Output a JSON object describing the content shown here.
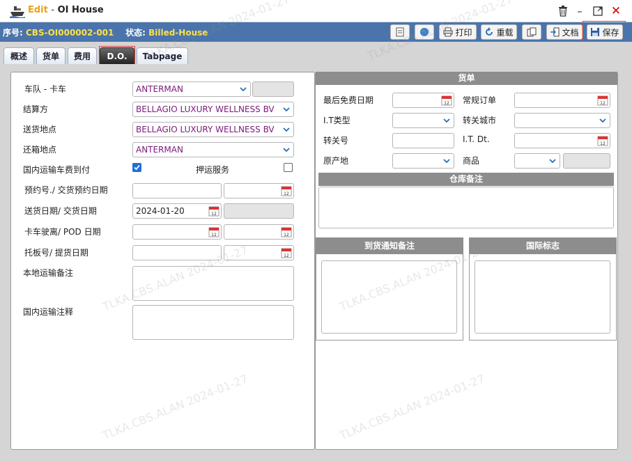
{
  "window": {
    "mode": "Edit",
    "separator": "-",
    "title": "OI House"
  },
  "infobar": {
    "serial_label": "序号:",
    "serial_value": "CBS-OI000002-001",
    "status_label": "状态:",
    "status_value": "Billed-House",
    "buttons": {
      "print": "打印",
      "reload": "重载",
      "docs": "文档",
      "save": "保存"
    }
  },
  "tabs": [
    {
      "label": "概述"
    },
    {
      "label": "货单"
    },
    {
      "label": "费用"
    },
    {
      "label": "D.O."
    },
    {
      "label": "Tabpage"
    }
  ],
  "left": {
    "fleet_truck": {
      "label": "车队 - 卡车",
      "value": "ANTERMAN"
    },
    "settlement": {
      "label": "结算方",
      "value": "BELLAGIO LUXURY WELLNESS BV"
    },
    "delivery_place": {
      "label": "送货地点",
      "value": "BELLAGIO LUXURY WELLNESS BV"
    },
    "return_place": {
      "label": "还箱地点",
      "value": "ANTERMAN"
    },
    "domestic_fee_paid": {
      "label": "国内运输车费到付",
      "checked": true
    },
    "escort_service": {
      "label": "押运服务",
      "checked": false
    },
    "booking": {
      "label": "预约号./ 交货预约日期",
      "value": "",
      "date": ""
    },
    "delivery_date": {
      "label": "送货日期/ 交货日期",
      "value": "2024-01-20"
    },
    "truck_departure": {
      "label": "卡车驶离/ POD 日期"
    },
    "pallet": {
      "label": "托板号/ 提货日期"
    },
    "local_note": {
      "label": "本地运输备注"
    },
    "domestic_note": {
      "label": "国内运输注释"
    }
  },
  "right": {
    "bill_header": "货单",
    "last_free_date": {
      "label": "最后免费日期"
    },
    "regular_order": {
      "label": "常规订单"
    },
    "it_type": {
      "label": "I.T类型"
    },
    "transfer_city": {
      "label": "转关城市"
    },
    "transfer_no": {
      "label": "转关号"
    },
    "it_dt": {
      "label": "I.T. Dt."
    },
    "origin": {
      "label": "原产地"
    },
    "goods": {
      "label": "商品"
    },
    "warehouse_header": "仓库备注",
    "arrival_header": "到货通知备注",
    "intl_header": "国际标志"
  },
  "watermark": "TLKA.CBS.ALAN 2024-01-27",
  "colors": {
    "infobar": "#4a74ab",
    "highlight": "#ffe14a",
    "edit": "#e8a317",
    "purple_text": "#7a1a7a",
    "section_header": "#8d8d8d"
  }
}
